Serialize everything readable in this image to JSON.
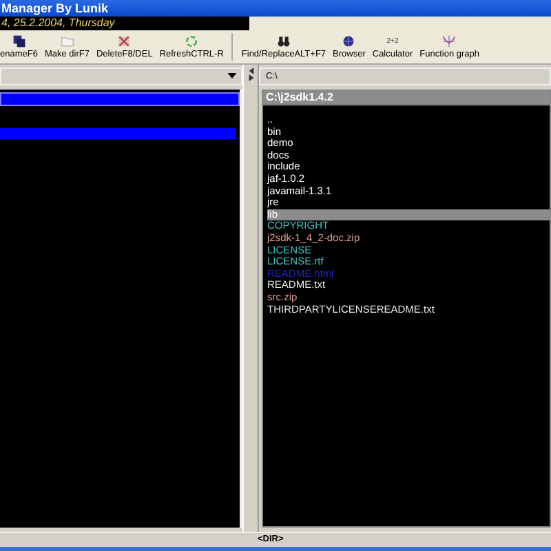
{
  "window": {
    "title": "Manager By Lunik"
  },
  "date_bar": {
    "text": "4, 25.2.2004, Thursday"
  },
  "toolbar": [
    {
      "label": "enameF6",
      "kind": "rename"
    },
    {
      "label": "Make dirF7",
      "kind": "folder"
    },
    {
      "label": "DeleteF8/DEL",
      "kind": "delete"
    },
    {
      "label": "RefreshCTRL-R",
      "kind": "refresh"
    },
    {
      "label": "Find/ReplaceALT+F7",
      "kind": "find"
    },
    {
      "label": "Browser",
      "kind": "browser"
    },
    {
      "label": "Calculator",
      "kind": "calc",
      "icon_text": "2+2"
    },
    {
      "label": "Function graph",
      "kind": "graph"
    }
  ],
  "right_pane": {
    "path": "C:\\",
    "title": "C:\\j2sdk1.4.2",
    "files": [
      {
        "name": "..",
        "kind": "dir",
        "selected": false
      },
      {
        "name": "bin",
        "kind": "dir",
        "selected": false
      },
      {
        "name": "demo",
        "kind": "dir",
        "selected": false
      },
      {
        "name": "docs",
        "kind": "dir",
        "selected": false
      },
      {
        "name": "include",
        "kind": "dir",
        "selected": false
      },
      {
        "name": "jaf-1.0.2",
        "kind": "dir",
        "selected": false
      },
      {
        "name": "javamail-1.3.1",
        "kind": "dir",
        "selected": false
      },
      {
        "name": "jre",
        "kind": "dir",
        "selected": false
      },
      {
        "name": "lib",
        "kind": "dir",
        "selected": true
      },
      {
        "name": "COPYRIGHT",
        "kind": "doc",
        "selected": false
      },
      {
        "name": "j2sdk-1_4_2-doc.zip",
        "kind": "archive",
        "selected": false
      },
      {
        "name": "LICENSE",
        "kind": "doc",
        "selected": false
      },
      {
        "name": "LICENSE.rtf",
        "kind": "doc",
        "selected": false
      },
      {
        "name": "README.html",
        "kind": "html",
        "selected": false
      },
      {
        "name": "README.txt",
        "kind": "text",
        "selected": false
      },
      {
        "name": "src.zip",
        "kind": "archive",
        "selected": false
      },
      {
        "name": "THIRDPARTYLICENSEREADME.txt",
        "kind": "text",
        "selected": false
      }
    ]
  },
  "status_bar": {
    "text": "<DIR>"
  }
}
